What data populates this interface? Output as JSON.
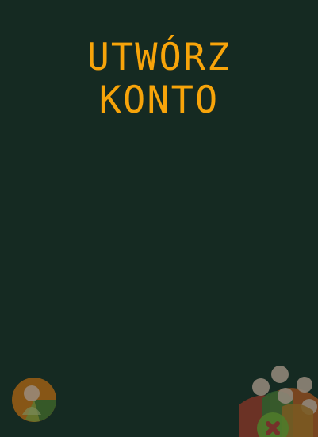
{
  "screen": {
    "title_line_1": "UTWÓRZ",
    "title_line_2": "KONTO"
  },
  "colors": {
    "background": "#152a22",
    "title": "#f7a40a"
  },
  "decorations": {
    "left_icon": "people-circle-icon",
    "right_icon": "people-group-icon"
  }
}
